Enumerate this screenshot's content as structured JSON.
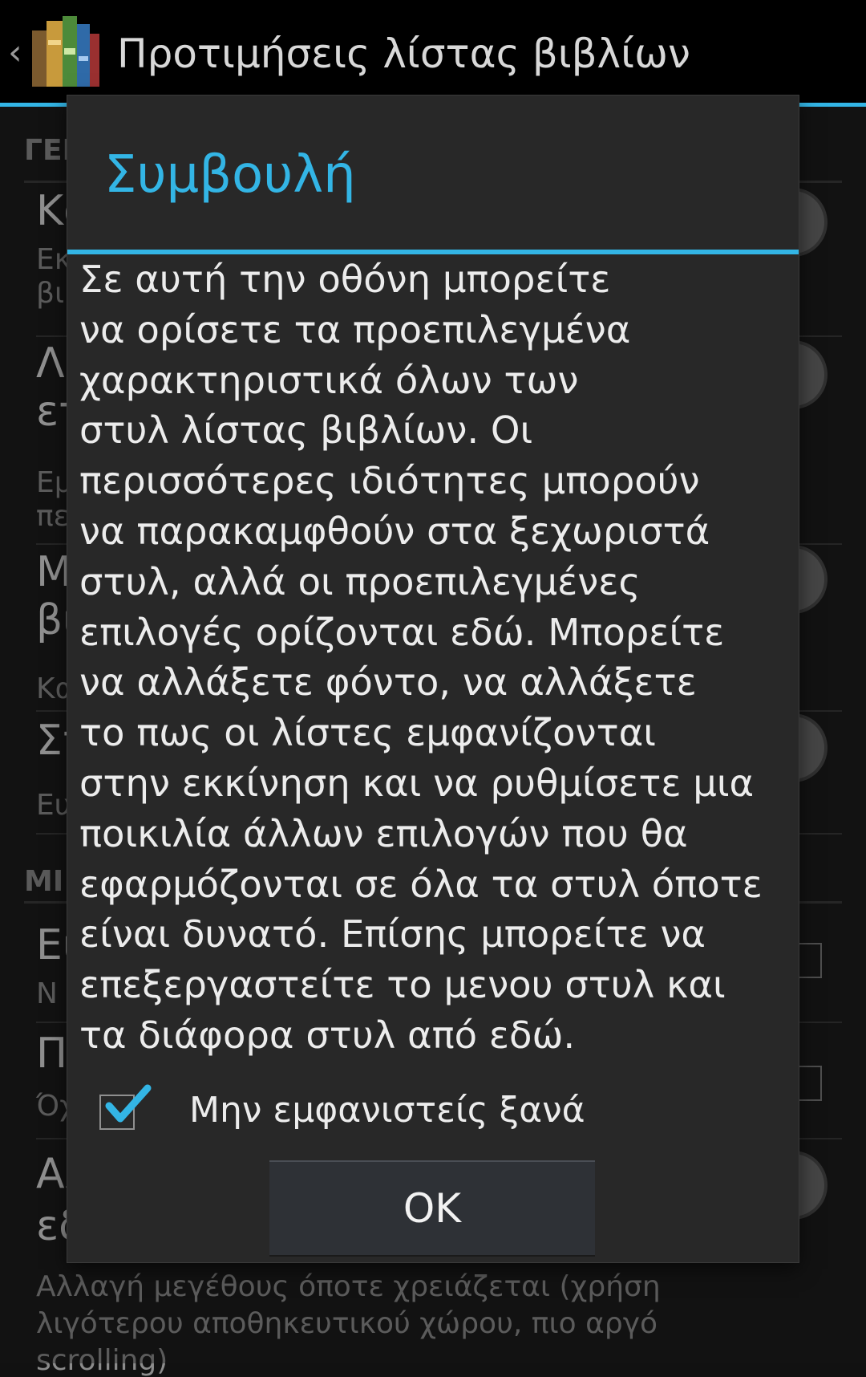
{
  "actionbar": {
    "title": "Προτιμήσεις λίστας βιβλίων",
    "accent_color": "#33b5e5",
    "icon": "book-stack-app-icon",
    "up_icon": "chevron-left-icon"
  },
  "background": {
    "cat1": "ΓΕΙ",
    "cat2": "ΜΙ",
    "p1_title": "Κα",
    "p1_sum_a": "Εκ",
    "p1_sum_b": "βι",
    "p2_title_a": "Λι",
    "p2_title_b": "ετ",
    "p2_sum_a": "Εμ",
    "p2_sum_b": "πε",
    "p3_title_a": "Μ",
    "p3_title_b": "βι",
    "p3_sum": "Κα",
    "p4_title": "Στ",
    "p4_sum": "Ευ",
    "p5_title": "Ει",
    "p5_sum": "Ν",
    "p6_title": "Π",
    "p6_sum": "Όχ",
    "p7_title_a": "Αλ",
    "p7_title_b": "εδ",
    "p7_sum_a": "Αλλαγή μεγέθους όποτε χρειάζεται (χρήση",
    "p7_sum_b": "λιγότερου αποθηκευτικού χώρου, πιο αργό",
    "p7_sum_c": "scrolling)"
  },
  "dialog": {
    "title": "Συμβουλή",
    "body_lines": [
      "Σε αυτή την οθόνη μπορείτε",
      "να ορίσετε τα προεπιλεγμένα",
      "χαρακτηριστικά όλων των",
      "στυλ λίστας βιβλίων. Οι",
      "περισσότερες ιδιότητες μπορούν",
      "να παρακαμφθούν στα ξεχωριστά",
      "στυλ, αλλά οι προεπιλεγμένες",
      "επιλογές ορίζονται εδώ. Μπορείτε",
      "να αλλάξετε φόντο, να αλλάξετε",
      "το πως οι λίστες εμφανίζονται",
      "στην εκκίνηση και να ρυθμίσετε μια",
      "ποικιλία άλλων επιλογών που θα",
      "εφαρμόζονται σε όλα τα στυλ όποτε",
      "είναι δυνατό. Επίσης μπορείτε να",
      "επεξεργαστείτε το μενου στυλ και",
      "τα διάφορα στυλ από εδώ."
    ],
    "checkbox_label": "Μην εμφανιστείς ξανά",
    "checkbox_checked": true,
    "ok_label": "OK"
  }
}
